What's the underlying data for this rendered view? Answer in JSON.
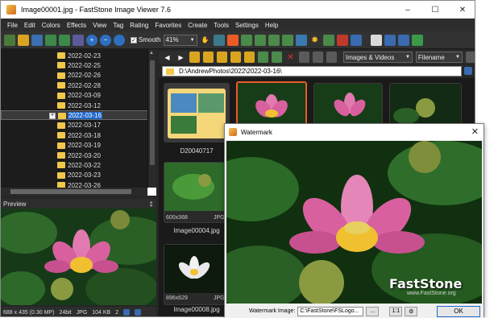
{
  "window": {
    "title": "Image00001.jpg - FastStone Image Viewer 7.6",
    "minimize": "–",
    "maximize": "☐",
    "close": "✕"
  },
  "menu": [
    "File",
    "Edit",
    "Colors",
    "Effects",
    "View",
    "Tag",
    "Rating",
    "Favorites",
    "Create",
    "Tools",
    "Settings",
    "Help"
  ],
  "toolbar": {
    "smooth_label": "Smooth",
    "smooth_checked": "✓",
    "zoom_value": "41%"
  },
  "tree": {
    "folders": [
      "2022-02-23",
      "2022-02-25",
      "2022-02-26",
      "2022-02-28",
      "2022-03-09",
      "2022-03-12",
      "2022-03-16",
      "2022-03-17",
      "2022-03-18",
      "2022-03-19",
      "2022-03-20",
      "2022-03-22",
      "2022-03-23",
      "2022-03-26"
    ],
    "selected": "2022-03-16",
    "expand_symbol": "+"
  },
  "nav": {
    "filter_value": "Images & Videos",
    "sort_value": "Filename"
  },
  "path": {
    "value": "D:\\AndrewPhotos\\2022\\2022-03-16\\"
  },
  "preview": {
    "header": "Preview",
    "pin": "‡"
  },
  "status": {
    "dimensions": "688 x 435 (0.30 MP)",
    "bitdepth": "24bit",
    "format": "JPG",
    "size": "104 KB",
    "count": "2"
  },
  "thumbnails": [
    {
      "caption": "D20040717",
      "info": ""
    },
    {
      "caption": "",
      "info": ""
    },
    {
      "caption": "",
      "info": ""
    },
    {
      "caption": "",
      "info": ""
    },
    {
      "caption": "Image00004.jpg",
      "info": "600x368",
      "type": "JPG"
    },
    {
      "caption": "Image00008.jpg",
      "info": "896x629",
      "type": "JPG"
    }
  ],
  "dialog": {
    "title": "Watermark",
    "close": "✕",
    "watermark_label": "Watermark Image:",
    "watermark_value": "C:\\FastStone\\FSLogo...",
    "browse": "...",
    "ratio": "1:1",
    "ok": "OK",
    "overlay_text": "FastStone",
    "overlay_url": "www.FastStone.org"
  }
}
